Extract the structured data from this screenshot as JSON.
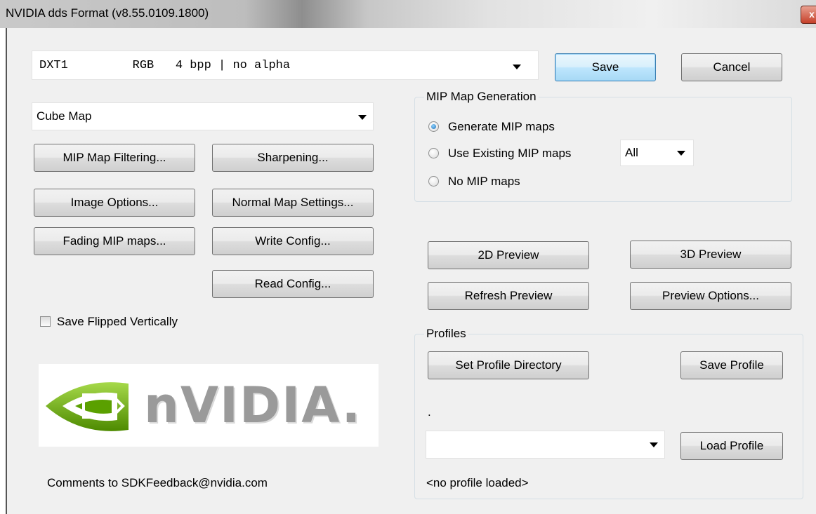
{
  "window": {
    "title": "NVIDIA dds Format (v8.55.0109.1800)",
    "close_glyph": "x"
  },
  "format": {
    "value": "DXT1         RGB   4 bpp | no alpha"
  },
  "buttons": {
    "save": "Save",
    "cancel": "Cancel"
  },
  "texture_type": {
    "value": "Cube Map"
  },
  "left_buttons": {
    "mip_filtering": "MIP Map Filtering...",
    "sharpening": "Sharpening...",
    "image_options": "Image Options...",
    "normal_map": "Normal Map Settings...",
    "fading": "Fading MIP maps...",
    "write_config": "Write Config...",
    "read_config": "Read Config..."
  },
  "mip_group": {
    "label": "MIP Map Generation",
    "generate": "Generate MIP maps",
    "use_existing": "Use Existing MIP maps",
    "none": "No MIP maps",
    "existing_count": "All",
    "selected": "generate"
  },
  "flip": {
    "label": "Save Flipped Vertically",
    "checked": false
  },
  "preview": {
    "preview_2d": "2D Preview",
    "preview_3d": "3D Preview",
    "refresh": "Refresh Preview",
    "options": "Preview Options..."
  },
  "profiles": {
    "label": "Profiles",
    "set_directory": "Set Profile Directory",
    "save": "Save Profile",
    "directory": ".",
    "selected": "",
    "load": "Load Profile",
    "status": "<no profile loaded>"
  },
  "logo": {
    "text": "nVIDIA."
  },
  "footer": {
    "comments": "Comments to SDKFeedback@nvidia.com"
  },
  "colors": {
    "nvidia_green": "#76b900",
    "accent_blue": "#3c7fb1"
  }
}
